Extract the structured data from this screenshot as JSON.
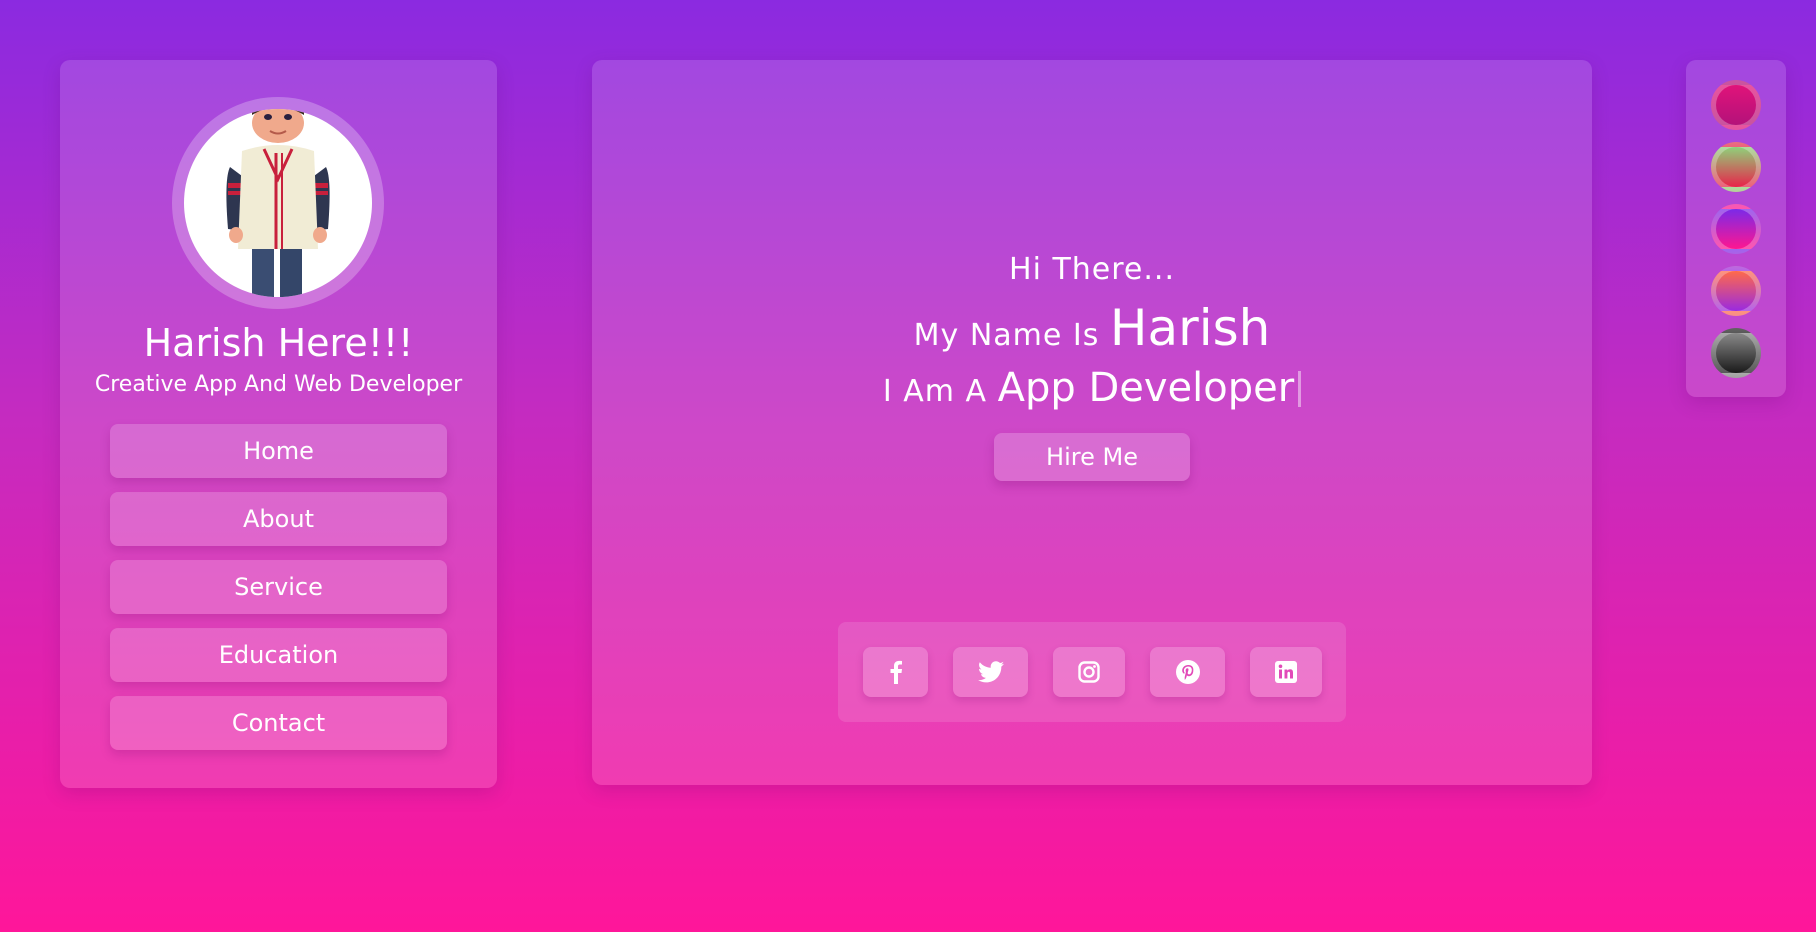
{
  "profile": {
    "name": "Harish Here!!!",
    "tagline": "Creative App And Web Developer",
    "avatar_icon": "cartoon-boy-avatar"
  },
  "nav": {
    "items": [
      {
        "label": "Home"
      },
      {
        "label": "About"
      },
      {
        "label": "Service"
      },
      {
        "label": "Education"
      },
      {
        "label": "Contact"
      }
    ]
  },
  "hero": {
    "greeting": "Hi There...",
    "name_prefix": "My Name Is",
    "name": "Harish",
    "role_prefix": "I Am A",
    "role": "App Developer",
    "hire_label": "Hire Me"
  },
  "social": {
    "icons": [
      "facebook-icon",
      "twitter-icon",
      "instagram-icon",
      "pinterest-icon",
      "linkedin-icon"
    ]
  },
  "theme_switcher": {
    "swatches": [
      {
        "name": "magenta",
        "colors": [
          "#e0137a",
          "#b4127a"
        ]
      },
      {
        "name": "green-red",
        "colors": [
          "#8fd17a",
          "#e8244a"
        ]
      },
      {
        "name": "purple-pink",
        "colors": [
          "#7b2ae8",
          "#ff1690"
        ]
      },
      {
        "name": "orange-purple",
        "colors": [
          "#ff6a4a",
          "#9a2ae0"
        ]
      },
      {
        "name": "gray-black",
        "colors": [
          "#8a8a8a",
          "#1a1a1a"
        ]
      }
    ]
  },
  "colors": {
    "background_top": "#8b2ae0",
    "background_bottom": "#ff169a"
  }
}
